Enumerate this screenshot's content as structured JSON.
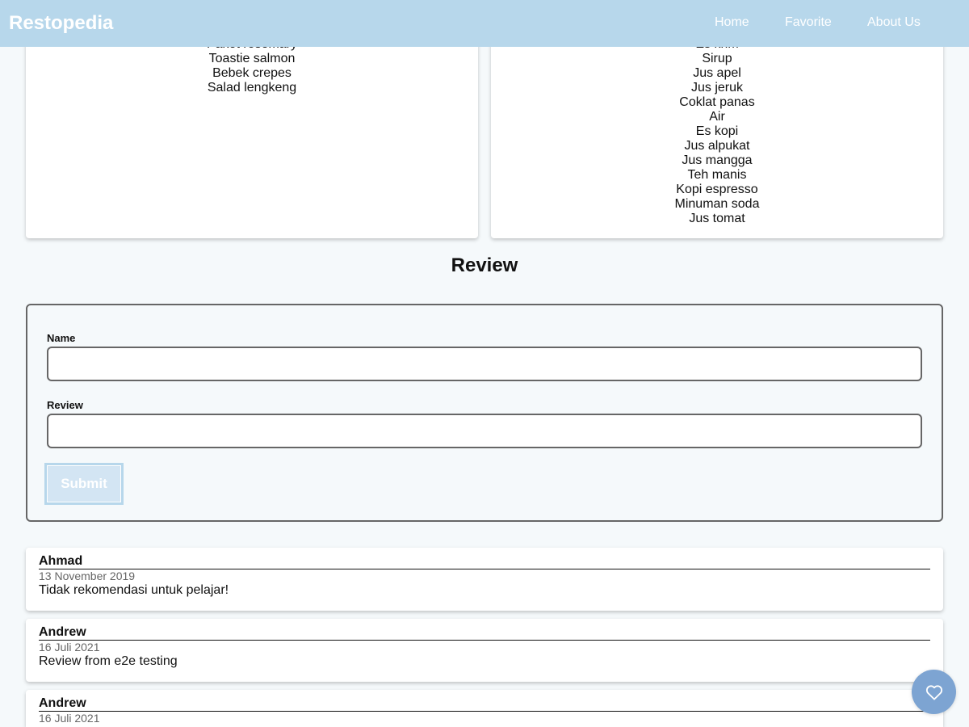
{
  "header": {
    "brand": "Restopedia",
    "nav": [
      {
        "label": "Home"
      },
      {
        "label": "Favorite"
      },
      {
        "label": "About Us"
      }
    ]
  },
  "menus": {
    "foods": [
      "Paket rosemary",
      "Toastie salmon",
      "Bebek crepes",
      "Salad lengkeng"
    ],
    "drinks": [
      "Es krim",
      "Sirup",
      "Jus apel",
      "Jus jeruk",
      "Coklat panas",
      "Air",
      "Es kopi",
      "Jus alpukat",
      "Jus mangga",
      "Teh manis",
      "Kopi espresso",
      "Minuman soda",
      "Jus tomat"
    ]
  },
  "review_section": {
    "title": "Review",
    "form": {
      "name_label": "Name",
      "name_value": "",
      "review_label": "Review",
      "review_value": "",
      "submit_label": "Submit"
    }
  },
  "reviews": [
    {
      "name": "Ahmad",
      "date": "13 November 2019",
      "text": "Tidak rekomendasi untuk pelajar!"
    },
    {
      "name": "Andrew",
      "date": "16 Juli 2021",
      "text": "Review from e2e testing"
    },
    {
      "name": "Andrew",
      "date": "16 Juli 2021",
      "text": ""
    }
  ],
  "fab": {
    "icon": "heart-outline-icon"
  },
  "colors": {
    "header_bg": "#b7d7eb",
    "page_bg": "#f5f9fb",
    "fab_bg": "#7da4d2",
    "submit_bg": "#d3e5f3"
  }
}
